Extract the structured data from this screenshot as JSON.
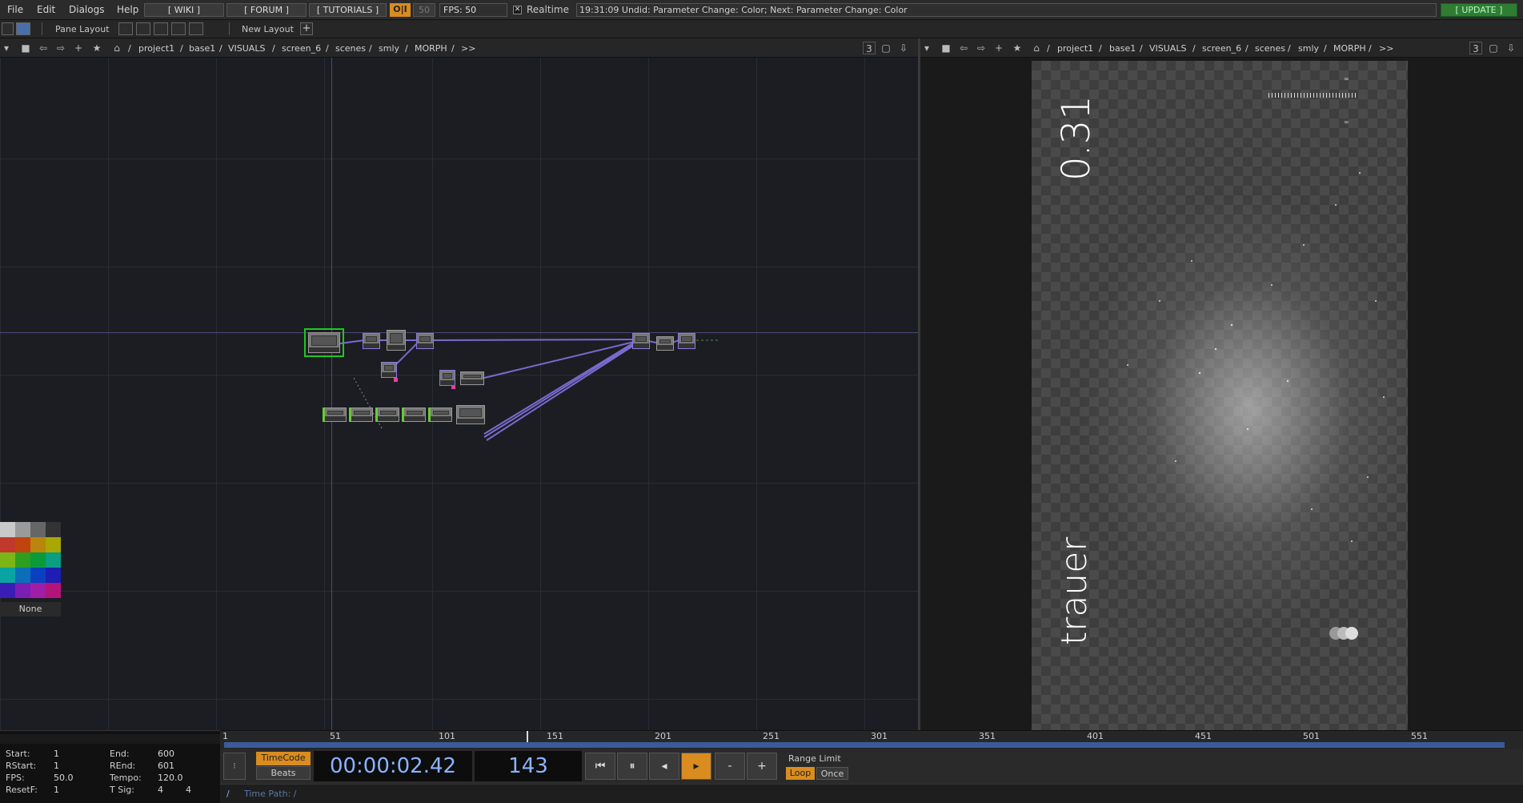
{
  "menubar": {
    "file": "File",
    "edit": "Edit",
    "dialogs": "Dialogs",
    "help": "Help",
    "wiki": "[ WIKI ]",
    "forum": "[ FORUM ]",
    "tutorials": "[ TUTORIALS ]",
    "oi": "O|I",
    "fifty": "50",
    "fps": "FPS:  50",
    "realtime": "Realtime",
    "status": "19:31:09 Undid: Parameter Change: Color; Next: Parameter Change: Color",
    "update": "[ UPDATE ]"
  },
  "bar2": {
    "pane_layout": "Pane Layout",
    "new_layout": "New Layout"
  },
  "left_path": {
    "crumbs": [
      "project1",
      "base1",
      "VISUALS",
      "screen_6",
      "scenes",
      "smly",
      "MORPH",
      ">>"
    ],
    "pane_num": "3"
  },
  "right_path": {
    "crumbs": [
      "project1",
      "base1",
      "VISUALS",
      "screen_6",
      "scenes",
      "smly",
      "MORPH",
      ">>"
    ],
    "pane_num": "3"
  },
  "viewer": {
    "value_text": "0.31",
    "word_text": "trauer"
  },
  "palette": {
    "none_label": "None",
    "colors": [
      "#c9c9c9",
      "#9a9a9a",
      "#666666",
      "#333333",
      "#c0392b",
      "#c1440e",
      "#b8860b",
      "#a8a800",
      "#7cb518",
      "#2e9e1f",
      "#0b9a3a",
      "#0a9e82",
      "#0aa3a3",
      "#0a6fb8",
      "#0a3fbf",
      "#1e1eb4",
      "#3a1eb4",
      "#7a1eb4",
      "#a01ea6",
      "#b4147a"
    ]
  },
  "timeline": {
    "ticks": [
      "1",
      "51",
      "101",
      "151",
      "201",
      "251",
      "301",
      "351",
      "401",
      "451",
      "501",
      "551"
    ]
  },
  "info": {
    "start_label": "Start:",
    "start": "1",
    "end_label": "End:",
    "end": "600",
    "rstart_label": "RStart:",
    "rstart": "1",
    "rend_label": "REnd:",
    "rend": "601",
    "fps_label": "FPS:",
    "fps": "50.0",
    "tempo_label": "Tempo:",
    "tempo": "120.0",
    "resetf_label": "ResetF:",
    "resetf": "1",
    "tsig_label": "T Sig:",
    "tsig_a": "4",
    "tsig_b": "4"
  },
  "transport": {
    "timecode_label": "TimeCode",
    "beats_label": "Beats",
    "timecode": "00:00:02.42",
    "frame": "143",
    "range_limit": "Range Limit",
    "loop": "Loop",
    "once": "Once",
    "minus": "-",
    "plus": "+"
  },
  "timepath": {
    "slash": "/",
    "label": "Time Path: /"
  },
  "colors": {
    "accent": "#d98c1f",
    "update_green": "#2e7d32",
    "selection": "#1ec81e",
    "wire": "#7a6ad0"
  }
}
